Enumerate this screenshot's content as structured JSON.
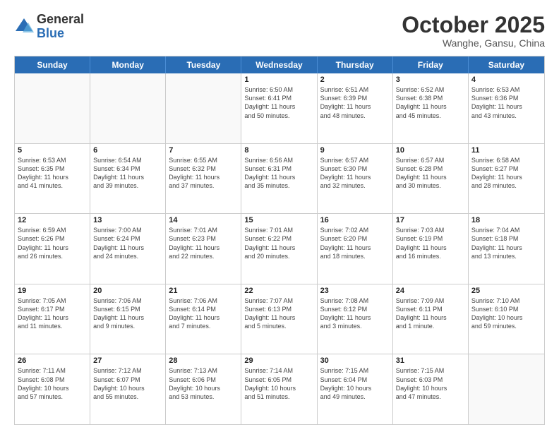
{
  "header": {
    "logo_general": "General",
    "logo_blue": "Blue",
    "month": "October 2025",
    "location": "Wanghe, Gansu, China"
  },
  "weekdays": [
    "Sunday",
    "Monday",
    "Tuesday",
    "Wednesday",
    "Thursday",
    "Friday",
    "Saturday"
  ],
  "weeks": [
    [
      {
        "day": "",
        "info": ""
      },
      {
        "day": "",
        "info": ""
      },
      {
        "day": "",
        "info": ""
      },
      {
        "day": "1",
        "info": "Sunrise: 6:50 AM\nSunset: 6:41 PM\nDaylight: 11 hours\nand 50 minutes."
      },
      {
        "day": "2",
        "info": "Sunrise: 6:51 AM\nSunset: 6:39 PM\nDaylight: 11 hours\nand 48 minutes."
      },
      {
        "day": "3",
        "info": "Sunrise: 6:52 AM\nSunset: 6:38 PM\nDaylight: 11 hours\nand 45 minutes."
      },
      {
        "day": "4",
        "info": "Sunrise: 6:53 AM\nSunset: 6:36 PM\nDaylight: 11 hours\nand 43 minutes."
      }
    ],
    [
      {
        "day": "5",
        "info": "Sunrise: 6:53 AM\nSunset: 6:35 PM\nDaylight: 11 hours\nand 41 minutes."
      },
      {
        "day": "6",
        "info": "Sunrise: 6:54 AM\nSunset: 6:34 PM\nDaylight: 11 hours\nand 39 minutes."
      },
      {
        "day": "7",
        "info": "Sunrise: 6:55 AM\nSunset: 6:32 PM\nDaylight: 11 hours\nand 37 minutes."
      },
      {
        "day": "8",
        "info": "Sunrise: 6:56 AM\nSunset: 6:31 PM\nDaylight: 11 hours\nand 35 minutes."
      },
      {
        "day": "9",
        "info": "Sunrise: 6:57 AM\nSunset: 6:30 PM\nDaylight: 11 hours\nand 32 minutes."
      },
      {
        "day": "10",
        "info": "Sunrise: 6:57 AM\nSunset: 6:28 PM\nDaylight: 11 hours\nand 30 minutes."
      },
      {
        "day": "11",
        "info": "Sunrise: 6:58 AM\nSunset: 6:27 PM\nDaylight: 11 hours\nand 28 minutes."
      }
    ],
    [
      {
        "day": "12",
        "info": "Sunrise: 6:59 AM\nSunset: 6:26 PM\nDaylight: 11 hours\nand 26 minutes."
      },
      {
        "day": "13",
        "info": "Sunrise: 7:00 AM\nSunset: 6:24 PM\nDaylight: 11 hours\nand 24 minutes."
      },
      {
        "day": "14",
        "info": "Sunrise: 7:01 AM\nSunset: 6:23 PM\nDaylight: 11 hours\nand 22 minutes."
      },
      {
        "day": "15",
        "info": "Sunrise: 7:01 AM\nSunset: 6:22 PM\nDaylight: 11 hours\nand 20 minutes."
      },
      {
        "day": "16",
        "info": "Sunrise: 7:02 AM\nSunset: 6:20 PM\nDaylight: 11 hours\nand 18 minutes."
      },
      {
        "day": "17",
        "info": "Sunrise: 7:03 AM\nSunset: 6:19 PM\nDaylight: 11 hours\nand 16 minutes."
      },
      {
        "day": "18",
        "info": "Sunrise: 7:04 AM\nSunset: 6:18 PM\nDaylight: 11 hours\nand 13 minutes."
      }
    ],
    [
      {
        "day": "19",
        "info": "Sunrise: 7:05 AM\nSunset: 6:17 PM\nDaylight: 11 hours\nand 11 minutes."
      },
      {
        "day": "20",
        "info": "Sunrise: 7:06 AM\nSunset: 6:15 PM\nDaylight: 11 hours\nand 9 minutes."
      },
      {
        "day": "21",
        "info": "Sunrise: 7:06 AM\nSunset: 6:14 PM\nDaylight: 11 hours\nand 7 minutes."
      },
      {
        "day": "22",
        "info": "Sunrise: 7:07 AM\nSunset: 6:13 PM\nDaylight: 11 hours\nand 5 minutes."
      },
      {
        "day": "23",
        "info": "Sunrise: 7:08 AM\nSunset: 6:12 PM\nDaylight: 11 hours\nand 3 minutes."
      },
      {
        "day": "24",
        "info": "Sunrise: 7:09 AM\nSunset: 6:11 PM\nDaylight: 11 hours\nand 1 minute."
      },
      {
        "day": "25",
        "info": "Sunrise: 7:10 AM\nSunset: 6:10 PM\nDaylight: 10 hours\nand 59 minutes."
      }
    ],
    [
      {
        "day": "26",
        "info": "Sunrise: 7:11 AM\nSunset: 6:08 PM\nDaylight: 10 hours\nand 57 minutes."
      },
      {
        "day": "27",
        "info": "Sunrise: 7:12 AM\nSunset: 6:07 PM\nDaylight: 10 hours\nand 55 minutes."
      },
      {
        "day": "28",
        "info": "Sunrise: 7:13 AM\nSunset: 6:06 PM\nDaylight: 10 hours\nand 53 minutes."
      },
      {
        "day": "29",
        "info": "Sunrise: 7:14 AM\nSunset: 6:05 PM\nDaylight: 10 hours\nand 51 minutes."
      },
      {
        "day": "30",
        "info": "Sunrise: 7:15 AM\nSunset: 6:04 PM\nDaylight: 10 hours\nand 49 minutes."
      },
      {
        "day": "31",
        "info": "Sunrise: 7:15 AM\nSunset: 6:03 PM\nDaylight: 10 hours\nand 47 minutes."
      },
      {
        "day": "",
        "info": ""
      }
    ]
  ]
}
